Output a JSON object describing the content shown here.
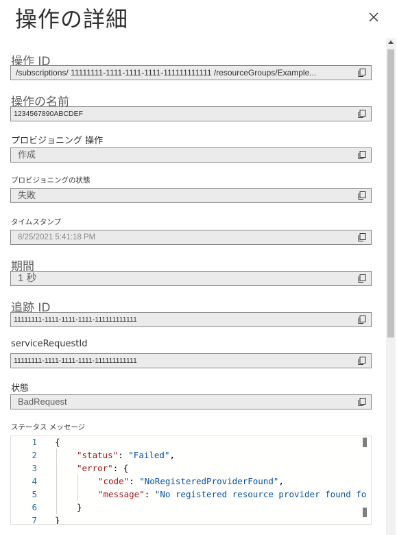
{
  "panel": {
    "title": "操作の詳細"
  },
  "fields": {
    "operation_id": {
      "label": "操作 ID",
      "value": "/subscriptions/ 11111111-1111-1111-1111-111111111111 /resourceGroups/Example..."
    },
    "operation_name": {
      "label": "操作の名前",
      "value": "1234567890ABCDEF"
    },
    "provisioning_operation": {
      "label": "プロビジョニング 操作",
      "value": "作成"
    },
    "provisioning_state": {
      "label": "プロビジョニングの状態",
      "value": "失敗"
    },
    "timestamp": {
      "label": "タイムスタンプ",
      "value": "8/25/2021 5:41:18 PM"
    },
    "duration": {
      "label": "期間",
      "value": "1 秒"
    },
    "tracking_id": {
      "label": "追跡 ID",
      "value": "11111111-1111-1111-1111-111111111111"
    },
    "service_request_id": {
      "label": "serviceRequestId",
      "value": "11111111-1111-1111-1111-111111111111"
    },
    "status": {
      "label": "状態",
      "value": "BadRequest"
    },
    "status_message": {
      "label": "ステータス メッセージ"
    }
  },
  "editor": {
    "line_numbers": [
      "1",
      "2",
      "3",
      "4",
      "5",
      "6",
      "7"
    ],
    "lines": {
      "l1_brace": "{",
      "l2_key": "\"status\"",
      "l2_colon": ": ",
      "l2_val": "\"Failed\"",
      "l2_end": ",",
      "l3_key": "\"error\"",
      "l3_rest": ": {",
      "l4_key": "\"code\"",
      "l4_colon": ": ",
      "l4_val": "\"NoRegisteredProviderFound\"",
      "l4_end": ",",
      "l5_key": "\"message\"",
      "l5_colon": ": ",
      "l5_val": "\"No registered resource provider found fo",
      "l6_brace": "}",
      "l7_brace": "}"
    }
  },
  "icons": {
    "close": "close-icon",
    "copy": "copy-icon"
  }
}
